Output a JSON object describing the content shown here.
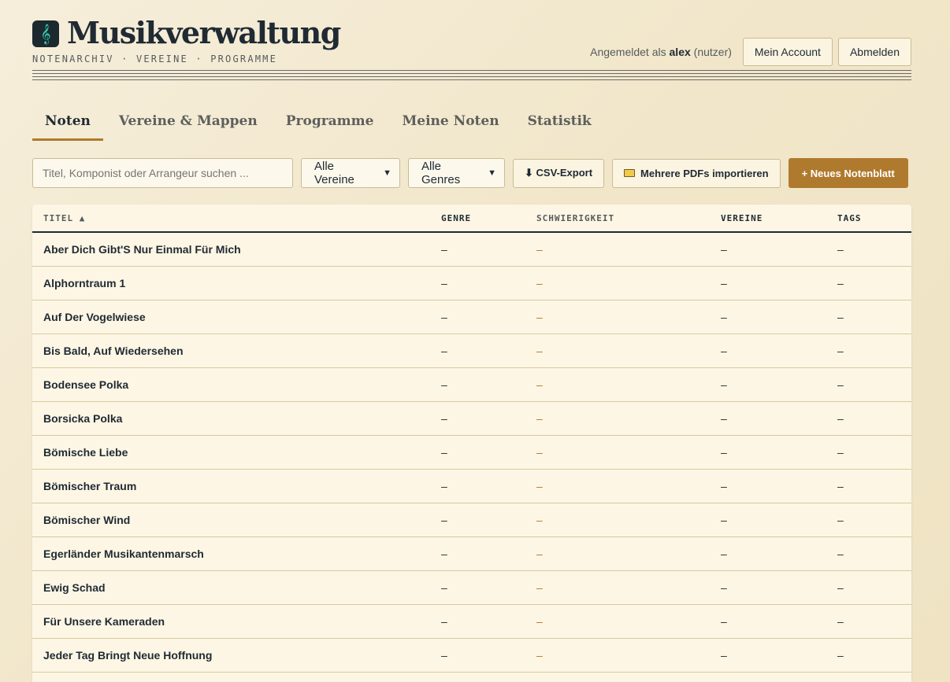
{
  "app": {
    "logo_glyph": "𝄞",
    "title": "Musikverwaltung",
    "subtitle": "NOTENARCHIV · VEREINE · PROGRAMME"
  },
  "user": {
    "logged_prefix": "Angemeldet als",
    "username": "alex",
    "role": "(nutzer)",
    "account_label": "Mein Account",
    "logout_label": "Abmelden"
  },
  "tabs": [
    {
      "label": "Noten",
      "active": true
    },
    {
      "label": "Vereine & Mappen",
      "active": false
    },
    {
      "label": "Programme",
      "active": false
    },
    {
      "label": "Meine Noten",
      "active": false
    },
    {
      "label": "Statistik",
      "active": false
    }
  ],
  "toolbar": {
    "search_placeholder": "Titel, Komponist oder Arrangeur suchen ...",
    "vereine_filter": "Alle Vereine",
    "genre_filter": "Alle Genres",
    "csv_label": "⬇ CSV-Export",
    "import_label": "Mehrere PDFs importieren",
    "new_label": "+ Neues Notenblatt"
  },
  "table": {
    "headers": [
      "TITEL ▲",
      "GENRE",
      "SCHWIERIGKEIT",
      "VEREINE",
      "TAGS"
    ],
    "rows": [
      [
        "Aber Dich Gibt'S Nur Einmal Für Mich",
        "–",
        "–",
        "–",
        "–"
      ],
      [
        "Alphorntraum 1",
        "–",
        "–",
        "–",
        "–"
      ],
      [
        "Auf Der Vogelwiese",
        "–",
        "–",
        "–",
        "–"
      ],
      [
        "Bis Bald, Auf Wiedersehen",
        "–",
        "–",
        "–",
        "–"
      ],
      [
        "Bodensee Polka",
        "–",
        "–",
        "–",
        "–"
      ],
      [
        "Borsicka Polka",
        "–",
        "–",
        "–",
        "–"
      ],
      [
        "Bömische Liebe",
        "–",
        "–",
        "–",
        "–"
      ],
      [
        "Bömischer Traum",
        "–",
        "–",
        "–",
        "–"
      ],
      [
        "Bömischer Wind",
        "–",
        "–",
        "–",
        "–"
      ],
      [
        "Egerländer Musikantenmarsch",
        "–",
        "–",
        "–",
        "–"
      ],
      [
        "Ewig Schad",
        "–",
        "–",
        "–",
        "–"
      ],
      [
        "Für Unsere Kameraden",
        "–",
        "–",
        "–",
        "–"
      ],
      [
        "Jeder Tag Bringt Neue Hoffnung",
        "–",
        "–",
        "–",
        "–"
      ]
    ]
  },
  "colors": {
    "accent": "#b07a2e",
    "ink": "#1f2a33",
    "paper": "#fdf6e4"
  }
}
